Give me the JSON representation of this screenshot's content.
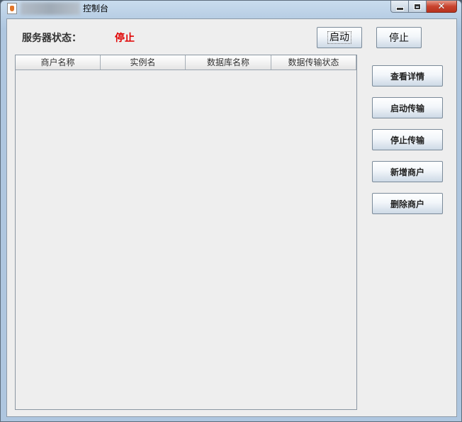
{
  "window": {
    "title": "控制台",
    "icon": "java-cup-icon"
  },
  "status": {
    "label": "服务器状态：",
    "value": "停止",
    "value_color": "#e00000"
  },
  "top_buttons": {
    "start_label": "启动",
    "stop_label": "停止"
  },
  "table": {
    "columns": [
      "商户名称",
      "实例名",
      "数据库名称",
      "数据传输状态"
    ],
    "rows": []
  },
  "side_buttons": {
    "details_label": "查看详情",
    "start_transfer_label": "启动传输",
    "stop_transfer_label": "停止传输",
    "add_merchant_label": "新增商户",
    "delete_merchant_label": "删除商户"
  }
}
